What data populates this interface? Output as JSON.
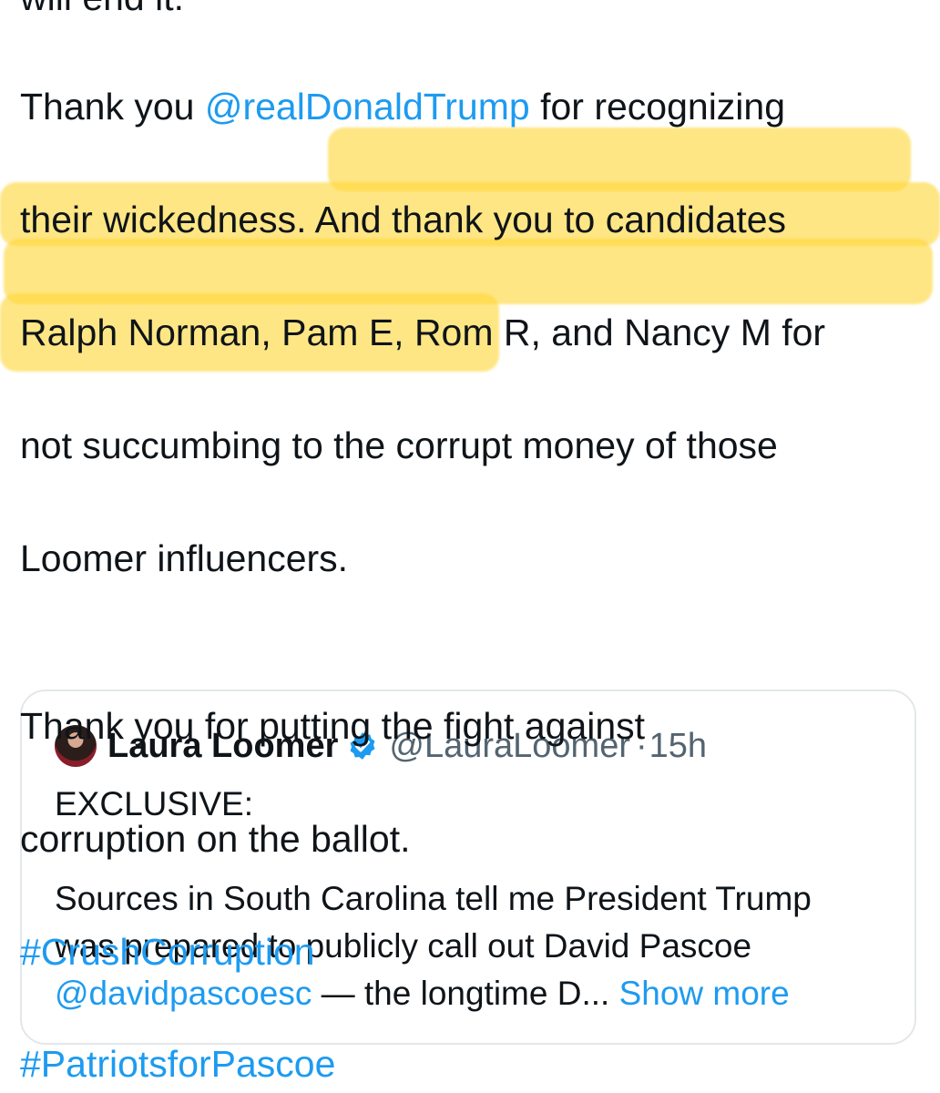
{
  "tweet": {
    "cut_top_line": "will end it.",
    "para1_line1_pre": "Thank you ",
    "para1_mention": "@realDonaldTrump",
    "para1_line1_post": "  for recognizing",
    "para1_line2_a": "their wickedness",
    "para1_line2_b": ". And thank you to candidates",
    "para1_line3": "Ralph Norman, Pam E, Rom R, and Nancy M for",
    "para1_line4": "not succumbing to the corrupt money of those",
    "para1_line5": "Loomer influencers.",
    "para2_line1": "Thank you for putting the fight against",
    "para2_line2": "corruption on the ballot.",
    "hashtag1": "#CrushCorruption",
    "hashtag2": "#PatriotsforPascoe"
  },
  "quote": {
    "author_name": "Laura Loomer",
    "author_handle": "@LauraLoomer",
    "separator": "·",
    "time": "15h",
    "line1": "EXCLUSIVE:",
    "line2": "Sources in South Carolina tell me President Trump",
    "line3": "was prepared to publicly call out David Pascoe",
    "line4_mention": "@davidpascoesc",
    "line4_text": " — the longtime D...",
    "show_more": " Show more"
  },
  "colors": {
    "link": "#1d9bf0",
    "text": "#0f1419",
    "secondary": "#536471",
    "highlight": "#ffd638",
    "verified_badge": "#1d9bf0"
  },
  "icons": {
    "verified": "verified-badge-icon",
    "avatar": "avatar-image"
  }
}
